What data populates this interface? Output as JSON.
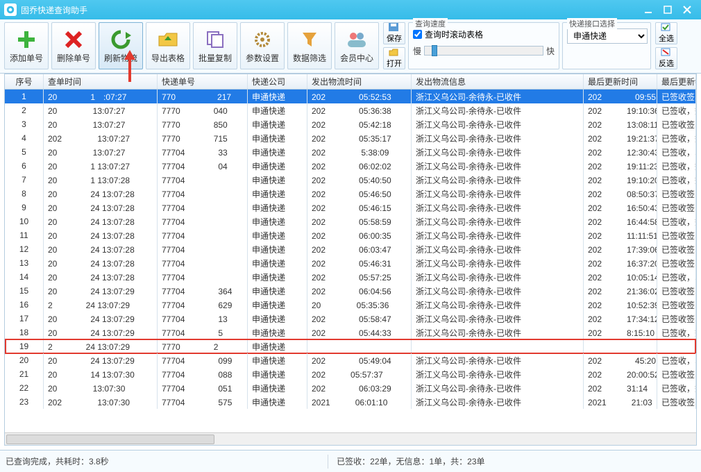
{
  "app": {
    "title": "固乔快递查询助手"
  },
  "toolbar": {
    "add": "添加单号",
    "del": "删除单号",
    "refresh": "刷新物流",
    "export": "导出表格",
    "batch": "批量复制",
    "params": "参数设置",
    "filter": "数据筛选",
    "member": "会员中心",
    "save": "保存",
    "open": "打开",
    "select_all": "全选",
    "invert": "反选"
  },
  "speed": {
    "legend": "查询速度",
    "slow": "慢",
    "fast": "快",
    "scroll_check": "查询时滚动表格"
  },
  "iface": {
    "legend": "快递接口选择",
    "selected": "申通快递"
  },
  "columns": [
    "序号",
    "查单时间",
    "快递单号",
    "快递公司",
    "发出物流时间",
    "发出物流信息",
    "最后更新时间",
    "最后更新物"
  ],
  "rows": [
    {
      "n": 1,
      "t": "20　　　　1　:07:27",
      "id": "770　　　　　217",
      "co": "申通快递",
      "ot": "202　　　　05:52:53",
      "info": "浙江义乌公司-余待永-已收件",
      "upd": "202　　　　09:55:41",
      "st": "已签收签收",
      "sel": true
    },
    {
      "n": 2,
      "t": "20　　　　 13:07:27",
      "id": "7770　　　　040",
      "co": "申通快递",
      "ot": "202　　　　05:36:38",
      "info": "浙江义乌公司-余待永-已收件",
      "upd": "202　　　19:10:36",
      "st": "已签收，签"
    },
    {
      "n": 3,
      "t": "20　　　　 13:07:27",
      "id": "7770　　　　850",
      "co": "申通快递",
      "ot": "202　　　　05:42:18",
      "info": "浙江义乌公司-余待永-已收件",
      "upd": "202　　　13:08:11",
      "st": "已签收签收"
    },
    {
      "n": 4,
      "t": "202　　　　 13:07:27",
      "id": "7770　　　　715",
      "co": "申通快递",
      "ot": "202　　　　05:35:17",
      "info": "浙江义乌公司-余待永-已收件",
      "upd": "202　　　19:21:37",
      "st": "已签收，签"
    },
    {
      "n": 5,
      "t": "20　　　　 13:07:27",
      "id": "77704　　　　33",
      "co": "申通快递",
      "ot": "202　　　　 5:38:09",
      "info": "浙江义乌公司-余待永-已收件",
      "upd": "202　　　12:30:43",
      "st": "已签收，收f"
    },
    {
      "n": 6,
      "t": "20　　　　1 13:07:27",
      "id": "77704　　　　04",
      "co": "申通快递",
      "ot": "202　　　　06:02:02",
      "info": "浙江义乌公司-余待永-已收件",
      "upd": "202　　　19:11:23",
      "st": "已签收，签"
    },
    {
      "n": 7,
      "t": "20　　　　1 13:07:28",
      "id": "77704　　　　",
      "co": "申通快递",
      "ot": "202　　　　05:40:50",
      "info": "浙江义乌公司-余待永-已收件",
      "upd": "202　　　19:10:20",
      "st": "已签收，签"
    },
    {
      "n": 8,
      "t": "20　　　　24 13:07:28",
      "id": "77704　　　　",
      "co": "申通快递",
      "ot": "202　　　　05:46:50",
      "info": "浙江义乌公司-余待永-已收件",
      "upd": "202　　　08:50:37",
      "st": "已签收签收"
    },
    {
      "n": 9,
      "t": "20　　　　24 13:07:28",
      "id": "77704　　　　",
      "co": "申通快递",
      "ot": "202　　　　05:46:15",
      "info": "浙江义乌公司-余待永-已收件",
      "upd": "202　　　16:50:43",
      "st": "已签收签收"
    },
    {
      "n": 10,
      "t": "20　　　　24 13:07:28",
      "id": "77704　　　　",
      "co": "申通快递",
      "ot": "202　　　　05:58:59",
      "info": "浙江义乌公司-余待永-已收件",
      "upd": "202　　　16:44:58",
      "st": "已签收，签"
    },
    {
      "n": 11,
      "t": "20　　　　24 13:07:28",
      "id": "77704　　　　",
      "co": "申通快递",
      "ot": "202　　　　06:00:35",
      "info": "浙江义乌公司-余待永-已收件",
      "upd": "202　　　11:11:51",
      "st": "已签收签收"
    },
    {
      "n": 12,
      "t": "20　　　　24 13:07:28",
      "id": "77704　　　　",
      "co": "申通快递",
      "ot": "202　　　　06:03:47",
      "info": "浙江义乌公司-余待永-已收件",
      "upd": "202　　　17:39:06",
      "st": "已签收签收"
    },
    {
      "n": 13,
      "t": "20　　　　24 13:07:28",
      "id": "77704　　　　",
      "co": "申通快递",
      "ot": "202　　　　05:46:31",
      "info": "浙江义乌公司-余待永-已收件",
      "upd": "202　　　16:37:20",
      "st": "已签收签收"
    },
    {
      "n": 14,
      "t": "20　　　　24 13:07:28",
      "id": "77704　　　　",
      "co": "申通快递",
      "ot": "202　　　　05:57:25",
      "info": "浙江义乌公司-余待永-已收件",
      "upd": "202　　　10:05:14",
      "st": "已签收，收f"
    },
    {
      "n": 15,
      "t": "20　　　　24 13:07:29",
      "id": "77704　　　　364",
      "co": "申通快递",
      "ot": "202　　　　06:04:56",
      "info": "浙江义乌公司-余待永-已收件",
      "upd": "202　　　21:36:02",
      "st": "已签收签收"
    },
    {
      "n": 16,
      "t": "2　　　　24 13:07:29",
      "id": "77704　　　　629",
      "co": "申通快递",
      "ot": "20　　　　 05:35:36",
      "info": "浙江义乌公司-余待永-已收件",
      "upd": "202　　　10:52:39",
      "st": "已签收签收"
    },
    {
      "n": 17,
      "t": "20　　　　24 13:07:29",
      "id": "77704　　　　13",
      "co": "申通快递",
      "ot": "202　　　　05:58:47",
      "info": "浙江义乌公司-余待永-已收件",
      "upd": "202　　　17:34:12",
      "st": "已签收签收"
    },
    {
      "n": 18,
      "t": "20　　　　24 13:07:29",
      "id": "77704　　　　5",
      "co": "申通快递",
      "ot": "202　　　　05:44:33",
      "info": "浙江义乌公司-余待永-已收件",
      "upd": "202　　　8:15:10",
      "st": "已签收，签f"
    },
    {
      "n": 19,
      "t": "2　　　　24 13:07:29",
      "id": "7770　　　　2",
      "co": "申通快递",
      "ot": "",
      "info": "",
      "upd": "",
      "st": "",
      "hl": true
    },
    {
      "n": 20,
      "t": "20　　　　24 13:07:29",
      "id": "77704　　　　099",
      "co": "申通快递",
      "ot": "202　　　　05:49:04",
      "info": "浙江义乌公司-余待永-已收件",
      "upd": "202　　　　45:20",
      "st": "已签收，收f"
    },
    {
      "n": 21,
      "t": "20　　　　14 13:07:30",
      "id": "77704　　　　088",
      "co": "申通快递",
      "ot": "202　　　05:57:37",
      "info": "浙江义乌公司-余待永-已收件",
      "upd": "202　　　20:00:52",
      "st": "已签收签收"
    },
    {
      "n": 22,
      "t": "20　　　　 13:07:30",
      "id": "77704　　　　051",
      "co": "申通快递",
      "ot": "202　　　　06:03:29",
      "info": "浙江义乌公司-余待永-已收件",
      "upd": "202　　　31:14",
      "st": "已签收，签"
    },
    {
      "n": 23,
      "t": "202　　　　 13:07:30",
      "id": "77704　　　　575",
      "co": "申通快递",
      "ot": "2021　　　06:01:10",
      "info": "浙江义乌公司-余待永-已收件",
      "upd": "2021　　　21:03",
      "st": "已签收签收"
    }
  ],
  "status": {
    "left": "已查询完成，共耗时：3.8秒",
    "right": "已签收：22单，无信息：1单，共：23单"
  }
}
